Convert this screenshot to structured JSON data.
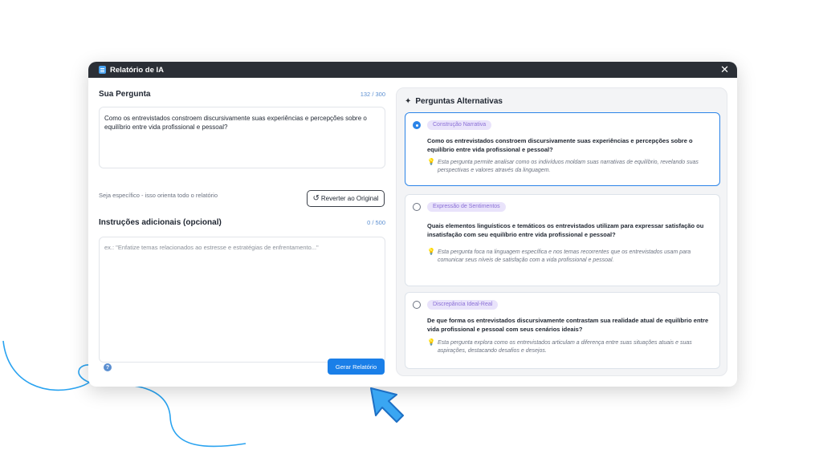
{
  "window": {
    "title": "Relatório de IA",
    "close": "✕"
  },
  "question": {
    "title": "Sua Pergunta",
    "counter": "132 / 300",
    "text": "Como os entrevistados constroem discursivamente suas experiências e percepções sobre o equilíbrio entre vida profissional e pessoal?",
    "hint": "Seja específico - isso orienta todo o relatório",
    "revert_label": "Reverter ao Original"
  },
  "instructions": {
    "title": "Instruções adicionais (opcional)",
    "counter": "0 / 500",
    "placeholder": "ex.: \"Enfatize temas relacionados ao estresse e estratégias de enfrentamento...\""
  },
  "footer": {
    "generate_label": "Gerar Relatório",
    "help": "?"
  },
  "alternatives": {
    "title": "Perguntas Alternativas",
    "items": [
      {
        "tag": "Construção Narrativa",
        "question": "Como os entrevistados constroem discursivamente suas experiências e percepções sobre o equilíbrio entre vida profissional e pessoal?",
        "note": "Esta pergunta permite analisar como os indivíduos moldam suas narrativas de equilíbrio, revelando suas perspectivas e valores através da linguagem.",
        "selected": true
      },
      {
        "tag": "Expressão de Sentimentos",
        "question": "Quais elementos linguísticos e temáticos os entrevistados utilizam para expressar satisfação ou insatisfação com seu equilíbrio entre vida profissional e pessoal?",
        "note": "Esta pergunta foca na linguagem específica e nos temas recorrentes que os entrevistados usam para comunicar seus níveis de satisfação com a vida profissional e pessoal.",
        "selected": false
      },
      {
        "tag": "Discrepância Ideal-Real",
        "question": "De que forma os entrevistados discursivamente contrastam sua realidade atual de equilíbrio entre vida profissional e pessoal com seus cenários ideais?",
        "note": "Esta pergunta explora como os entrevistados articulam a diferença entre suas situações atuais e suas aspirações, destacando desafios e desejos.",
        "selected": false
      }
    ]
  },
  "colors": {
    "accent": "#1a7fe8",
    "titlebar": "#2b2f36",
    "tag_bg": "#e9e3fb",
    "tag_text": "#8a6fd6",
    "decor": "#2aa3f0"
  },
  "icons": {
    "title": "document-icon",
    "revert": "undo-icon",
    "sparkle": "sparkle-icon",
    "note": "lightbulb-icon",
    "help": "help-icon",
    "cursor": "arrow-cursor-icon"
  }
}
